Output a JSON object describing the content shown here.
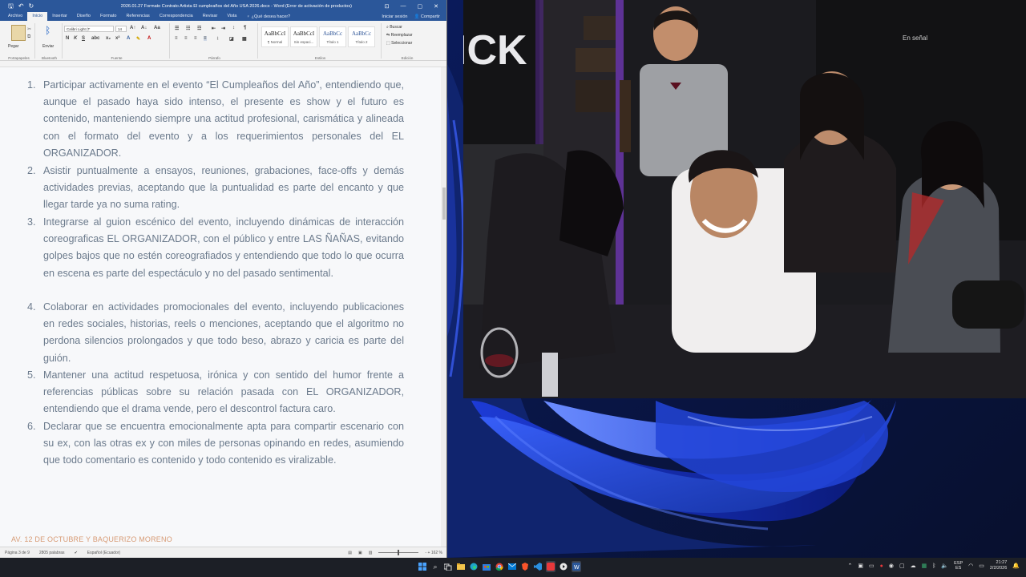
{
  "word": {
    "quick_access": {
      "save": "🖫",
      "undo": "↶",
      "redo": "↻"
    },
    "title": "2026.01.27 Formato Contrato Artista El cumpleaños del Año USA 2026.docx - Word (Error de activación de productos)",
    "tabs": [
      "Archivo",
      "Inicio",
      "Insertar",
      "Diseño",
      "Formato",
      "Referencias",
      "Correspondencia",
      "Revisar",
      "Vista"
    ],
    "active_tab": "Inicio",
    "tell_me": "¿Qué desea hacer?",
    "sign_in": "Iniciar sesión",
    "share": "Compartir",
    "ribbon": {
      "paste": "Pegar",
      "bluetooth": "Enviar",
      "font_name": "Calibri Light (T",
      "font_size": "14",
      "groups": [
        "Portapapeles",
        "Bluetooth",
        "Fuente",
        "Párrafo",
        "Estilos",
        "Edición"
      ],
      "styles": [
        {
          "preview": "AaBbCcI",
          "name": "¶ Normal"
        },
        {
          "preview": "AaBbCcI",
          "name": "Sin espaci..."
        },
        {
          "preview": "AaBbCc",
          "name": "Título 1"
        },
        {
          "preview": "AaBbCc",
          "name": "Título 2"
        }
      ],
      "edit": [
        "Buscar",
        "Reemplazar",
        "Seleccionar"
      ]
    },
    "document": {
      "clauses": [
        {
          "num": "1.",
          "text": "Participar activamente en el evento “El Cumpleaños del Año”, entendiendo que, aunque el pasado haya sido intenso, el presente es show y el futuro es contenido, manteniendo siempre una actitud profesional, carismática y alineada con el formato del evento y a los requerimientos personales del EL ORGANIZADOR."
        },
        {
          "num": "2.",
          "text": "Asistir puntualmente a ensayos, reuniones, grabaciones, face-offs y demás actividades previas, aceptando que la puntualidad es parte del encanto y que llegar tarde ya no suma rating."
        },
        {
          "num": "3.",
          "text": "Integrarse al guion escénico del evento, incluyendo dinámicas de interacción coreograficas EL ORGANIZADOR, con el público y entre LAS ÑAÑAS, evitando golpes bajos que no estén coreografiados y entendiendo que todo lo que ocurra en escena es parte del espectáculo y no del pasado sentimental."
        },
        {
          "num": "4.",
          "text": "Colaborar en actividades promocionales del evento, incluyendo publicaciones en redes sociales, historias, reels o menciones, aceptando que el algoritmo no perdona silencios prolongados y que todo beso, abrazo y caricia es parte del guión."
        },
        {
          "num": "5.",
          "text": "Mantener una actitud respetuosa, irónica y con sentido del humor frente a referencias públicas sobre su relación pasada con EL ORGANIZADOR, entendiendo que el drama vende, pero el descontrol factura caro."
        },
        {
          "num": "6.",
          "text": "Declarar que se encuentra emocionalmente apta para compartir escenario con su ex, con las otras ex y con miles de personas opinando en redes, asumiendo que todo comentario es contenido y todo contenido es viralizable."
        }
      ],
      "footer_text": "AV. 12 DE OCTUBRE Y BAQUERIZO MORENO"
    },
    "status": {
      "page": "Página 3 de 9",
      "words": "2805 palabras",
      "language": "Español (Ecuador)",
      "zoom": "- + 162 %"
    }
  },
  "video": {
    "sign": "ICK",
    "badge": "En señal"
  },
  "taskbar": {
    "icons": [
      "windows-icon",
      "search-icon",
      "taskview-icon",
      "explorer-icon",
      "edge-icon",
      "store-icon",
      "chrome-icon",
      "mail-icon",
      "brave-icon",
      "vscode-icon",
      "red-app-icon",
      "media-icon",
      "word-icon"
    ],
    "language": [
      "ESP",
      "ES"
    ],
    "time": "21:27",
    "date": "2/2/2026"
  },
  "colors": {
    "word_blue": "#2b579a",
    "doc_text": "#6b7a8c",
    "taskbar": "#1c1f26"
  }
}
